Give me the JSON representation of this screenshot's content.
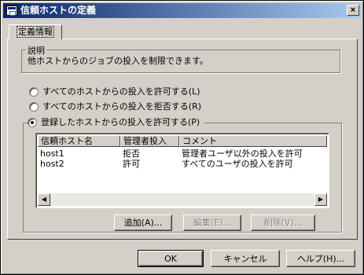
{
  "window": {
    "title": "信頼ホストの定義",
    "close_glyph": "×"
  },
  "tab": {
    "label": "定義情報"
  },
  "description": {
    "title": "説明",
    "text": "他ホストからのジョブの投入を制限できます。"
  },
  "radios": {
    "allow_all": "すべてのホストからの投入を許可する(L)",
    "deny_all": "すべてのホストからの投入を拒否する(R)",
    "allow_registered": "登録したホストからの投入を許可する(P)",
    "selected": "allow_registered"
  },
  "list": {
    "columns": [
      "信頼ホスト名",
      "管理者投入",
      "コメント"
    ],
    "rows": [
      [
        "host1",
        "拒否",
        "管理者ユーザ以外の投入を許可"
      ],
      [
        "host2",
        "許可",
        "すべてのユーザの投入を許可"
      ]
    ],
    "scroll_left_glyph": "◀",
    "scroll_right_glyph": "▶"
  },
  "list_buttons": {
    "add": "追加(A)...",
    "edit": "編集(E)...",
    "delete": "削除(V)..."
  },
  "footer": {
    "ok": "OK",
    "cancel": "キャンセル",
    "help": "ヘルプ(H)..."
  }
}
